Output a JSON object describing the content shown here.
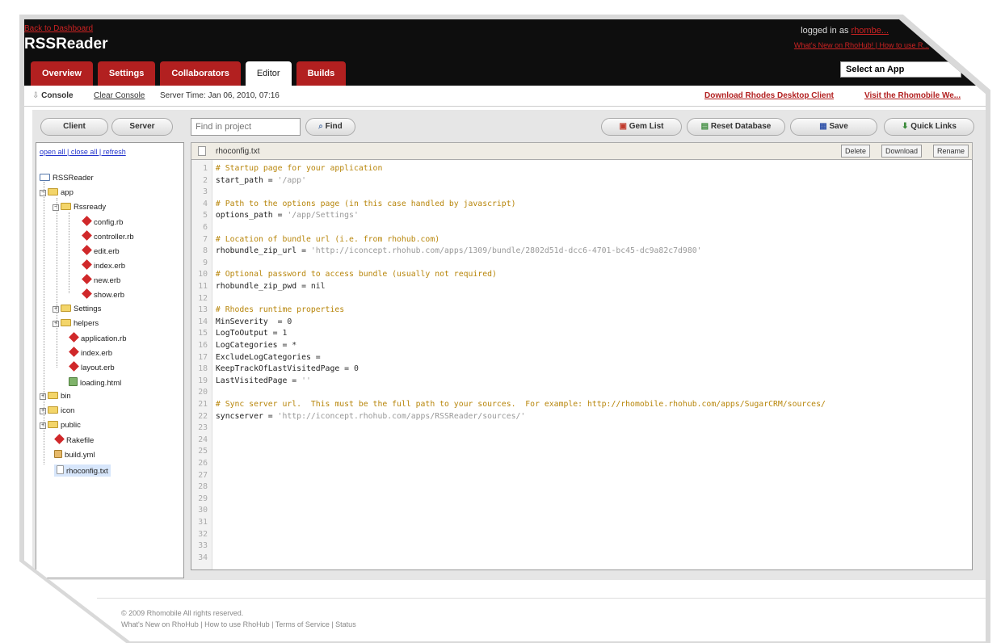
{
  "header": {
    "back_link": "Back to Dashboard",
    "app_title": "RSSReader",
    "logged_in_prefix": "logged in as",
    "user": "rhombe...",
    "whats_new": "What's New on RhoHub! | How to use R...",
    "select_app": "Select an App"
  },
  "tabs": [
    "Overview",
    "Settings",
    "Collaborators",
    "Editor",
    "Builds"
  ],
  "console": {
    "label": "Console",
    "clear": "Clear Console",
    "server_time": "Server Time: Jan 06, 2010, 07:16",
    "download_link": "Download Rhodes Desktop Client",
    "visit_link": "Visit the Rhomobile We..."
  },
  "left": {
    "client_tab": "Client",
    "server_tab": "Server",
    "links": "open all | close all | refresh"
  },
  "tree": [
    {
      "label": "RSSReader",
      "type": "root"
    },
    {
      "label": "app",
      "type": "folder"
    },
    {
      "label": "Rssready",
      "type": "folder"
    },
    {
      "label": "config.rb",
      "type": "ruby"
    },
    {
      "label": "controller.rb",
      "type": "ruby"
    },
    {
      "label": "edit.erb",
      "type": "ruby"
    },
    {
      "label": "index.erb",
      "type": "ruby"
    },
    {
      "label": "new.erb",
      "type": "ruby"
    },
    {
      "label": "show.erb",
      "type": "ruby"
    },
    {
      "label": "Settings",
      "type": "folder"
    },
    {
      "label": "helpers",
      "type": "folder"
    },
    {
      "label": "application.rb",
      "type": "ruby"
    },
    {
      "label": "index.erb",
      "type": "ruby"
    },
    {
      "label": "layout.erb",
      "type": "ruby"
    },
    {
      "label": "loading.html",
      "type": "html"
    },
    {
      "label": "bin",
      "type": "folder"
    },
    {
      "label": "icon",
      "type": "folder"
    },
    {
      "label": "public",
      "type": "folder"
    },
    {
      "label": "Rakefile",
      "type": "ruby"
    },
    {
      "label": "build.yml",
      "type": "yml"
    },
    {
      "label": "rhoconfig.txt",
      "type": "txt"
    }
  ],
  "toolbar": {
    "find_placeholder": "Find in project",
    "find": "Find",
    "gem_list": "Gem List",
    "reset_db": "Reset Database",
    "save": "Save",
    "quick_links": "Quick Links"
  },
  "file": {
    "name": "rhoconfig.txt",
    "delete": "Delete",
    "download": "Download",
    "rename": "Rename"
  },
  "code_lines": [
    "# Startup page for your application",
    "start_path = '/app'",
    "",
    "# Path to the options page (in this case handled by javascript)",
    "options_path = '/app/Settings'",
    "",
    "# Location of bundle url (i.e. from rhohub.com)",
    "rhobundle_zip_url = 'http://iconcept.rhohub.com/apps/1309/bundle/2802d51d-dcc6-4701-bc45-dc9a82c7d980'",
    "",
    "# Optional password to access bundle (usually not required)",
    "rhobundle_zip_pwd = nil",
    "",
    "# Rhodes runtime properties",
    "MinSeverity  = 0",
    "LogToOutput = 1",
    "LogCategories = *",
    "ExcludeLogCategories =",
    "KeepTrackOfLastVisitedPage = 0",
    "LastVisitedPage = ''",
    "",
    "# Sync server url.  This must be the full path to your sources.  For example: http://rhomobile.rhohub.com/apps/SugarCRM/sources/",
    "syncserver = 'http://iconcept.rhohub.com/apps/RSSReader/sources/'",
    "",
    "",
    "",
    "",
    "",
    "",
    "",
    "",
    "",
    "",
    "",
    ""
  ],
  "footer": {
    "copyright": "© 2009 Rhomobile All rights reserved.",
    "links": "What's New on RhoHub | How to use RhoHub | Terms of Service | Status"
  }
}
